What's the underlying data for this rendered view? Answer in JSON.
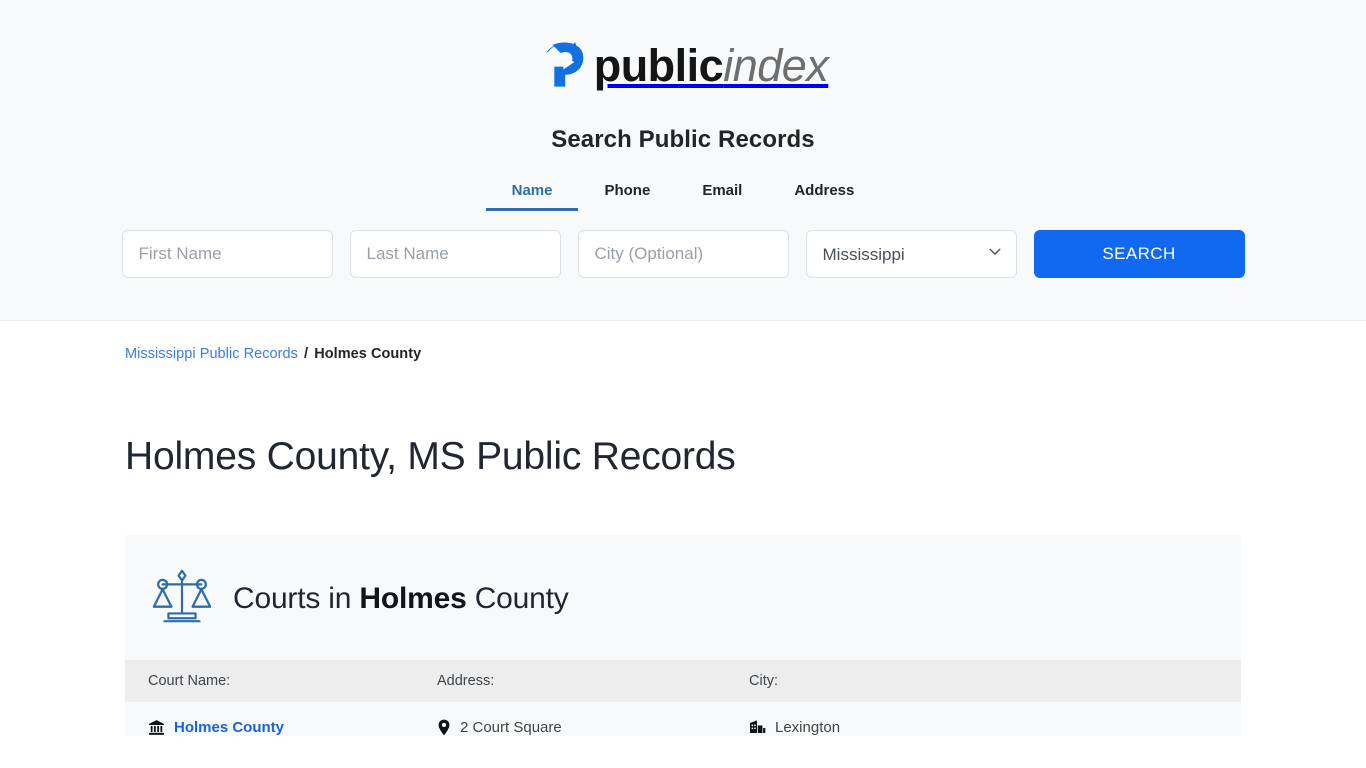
{
  "brand": {
    "logo_primary": "public",
    "logo_secondary": "index",
    "logo_mark_icon": "public-index-arrow-logo",
    "accent_blue": "#1069f0",
    "link_blue": "#3b7ddd"
  },
  "search": {
    "title": "Search Public Records",
    "tabs": [
      {
        "label": "Name",
        "active": true
      },
      {
        "label": "Phone",
        "active": false
      },
      {
        "label": "Email",
        "active": false
      },
      {
        "label": "Address",
        "active": false
      }
    ],
    "first_name_placeholder": "First Name",
    "first_name_value": "",
    "last_name_placeholder": "Last Name",
    "last_name_value": "",
    "city_placeholder": "City (Optional)",
    "city_value": "",
    "state_selected": "Mississippi",
    "state_options": [
      "Mississippi"
    ],
    "submit_label": "SEARCH"
  },
  "breadcrumb": {
    "parent_label": "Mississippi Public Records",
    "separator": "/",
    "current_label": "Holmes County"
  },
  "page": {
    "title": "Holmes County, MS Public Records"
  },
  "courts_card": {
    "icon": "scales-of-justice-icon",
    "heading_prefix": "Courts in ",
    "heading_bold": "Holmes",
    "heading_suffix": " County",
    "columns": [
      "Court Name:",
      "Address:",
      "City:"
    ],
    "rows": [
      {
        "name_icon": "courthouse-icon",
        "name": "Holmes County",
        "address_icon": "map-pin-icon",
        "address": "2 Court Square",
        "city_icon": "city-building-icon",
        "city": "Lexington"
      }
    ]
  }
}
